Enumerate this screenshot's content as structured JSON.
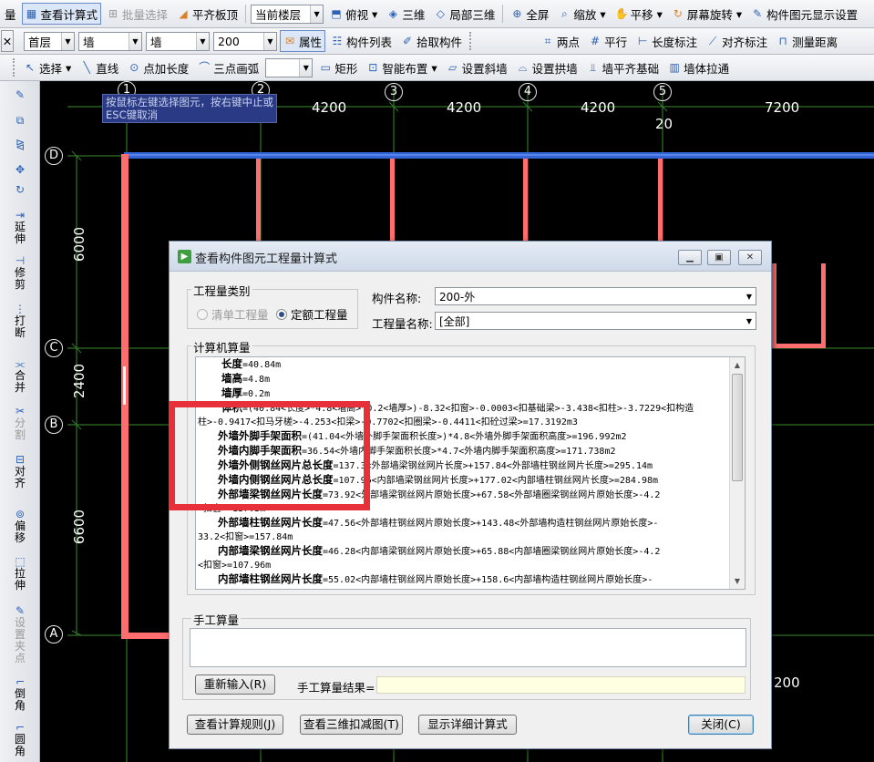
{
  "toolbar1": {
    "cut_label": "量",
    "view_calc": "查看计算式",
    "batch_select": "批量选择",
    "align_slab": "平齐板顶",
    "floor_combo": "当前楼层",
    "top_view": "俯视",
    "three_d": "三维",
    "local_3d": "局部三维",
    "fullscreen": "全屏",
    "zoom": "缩放",
    "pan": "平移",
    "rotate": "屏幕旋转",
    "display_settings": "构件图元显示设置"
  },
  "toolbar2": {
    "floor": "首层",
    "type1": "墙",
    "type2": "墙",
    "value": "200",
    "properties": "属性",
    "component_list": "构件列表",
    "pick": "拾取构件",
    "two_points": "两点",
    "parallel": "平行",
    "length_dim": "长度标注",
    "aligned_dim": "对齐标注",
    "measure": "测量距离"
  },
  "toolbar3": {
    "select": "选择",
    "line": "直线",
    "point_length": "点加长度",
    "arc3": "三点画弧",
    "rect": "矩形",
    "smart_layout": "智能布置",
    "slope_wall": "设置斜墙",
    "arch_wall": "设置拱墙",
    "wall_align": "墙平齐基础",
    "wall_stretch": "墙体拉通"
  },
  "left_tools": {
    "extend": "延伸",
    "trim": "修剪",
    "break": "打断",
    "merge": "合并",
    "split": "分割",
    "align": "对齐",
    "offset": "偏移",
    "stretch": "拉伸",
    "set_point": "设置夹点",
    "chamfer": "倒角",
    "fillet": "圆角"
  },
  "canvas": {
    "hint": "按鼠标左键选择图元，按右键中止或ESC键取消",
    "axis_x": [
      "1",
      "2",
      "3",
      "4",
      "5"
    ],
    "axis_y": [
      "D",
      "C",
      "B",
      "A"
    ],
    "dim_top": [
      "4200",
      "4200",
      "4200",
      "7200"
    ],
    "dim_20": "20",
    "dim_left": [
      "6000",
      "2400",
      "6600"
    ],
    "dim_bottom_right": "200"
  },
  "dialog": {
    "title": "查看构件图元工程量计算式",
    "type_group": "工程量类别",
    "radio_bill": "清单工程量",
    "radio_quota": "定额工程量",
    "comp_name_label": "构件名称:",
    "comp_name_value": "200-外",
    "qty_name_label": "工程量名称:",
    "qty_name_value": "[全部]",
    "calc_label": "计算机算量",
    "manual_label": "手工算量",
    "reinput": "重新输入(R)",
    "manual_result_label": "手工算量结果=",
    "btn_rules": "查看计算规则(J)",
    "btn_3d": "查看三维扣减图(T)",
    "btn_detail": "显示详细计算式",
    "btn_close": "关闭(C)"
  },
  "calc_lines": [
    {
      "bold": "长度",
      "rest": "=40.84m"
    },
    {
      "bold": "墙高",
      "rest": "=4.8m"
    },
    {
      "bold": "墙厚",
      "rest": "=0.2m"
    },
    {
      "bold": "体积",
      "rest": "=(40.84<长度>*4.8<墙高>*0.2<墙厚>)-8.32<扣窗>-0.0003<扣基础梁>-3.438<扣柱>-3.7229<扣构造"
    },
    {
      "bold": "",
      "rest": "柱>-0.9417<扣马牙槎>-4.253<扣梁>-0.7702<扣圈梁>-0.4411<扣砼过梁>=17.3192m3"
    },
    {
      "bold": "外墙外脚手架面积",
      "rest": "=(41.04<外墙外脚手架面积长度>)*4.8<外墙外脚手架面积高度>=196.992m2"
    },
    {
      "bold": "外墙内脚手架面积",
      "rest": "=36.54<外墙内脚手架面积长度>*4.7<外墙内脚手架面积高度>=171.738m2"
    },
    {
      "bold": "外墙外侧钢丝网片总长度",
      "rest": "=137.3<外部墙梁钢丝网片长度>+157.84<外部墙柱钢丝网片长度>=295.14m"
    },
    {
      "bold": "外墙内侧钢丝网片总长度",
      "rest": "=107.96<内部墙梁钢丝网片长度>+177.02<内部墙柱钢丝网片长度>=284.98m"
    },
    {
      "bold": "外部墙梁钢丝网片长度",
      "rest": "=73.92<外部墙梁钢丝网片原始长度>+67.58<外部墙圈梁钢丝网片原始长度>-4.2"
    },
    {
      "bold": "",
      "rest": "<扣窗>=137.3m"
    },
    {
      "bold": "外部墙柱钢丝网片长度",
      "rest": "=47.56<外部墙柱钢丝网片原始长度>+143.48<外部墙构造柱钢丝网片原始长度>-"
    },
    {
      "bold": "",
      "rest": "33.2<扣窗>=157.84m"
    },
    {
      "bold": "内部墙梁钢丝网片长度",
      "rest": "=46.28<内部墙梁钢丝网片原始长度>+65.88<内部墙圈梁钢丝网片原始长度>-4.2"
    },
    {
      "bold": "",
      "rest": "<扣窗>=107.96m"
    },
    {
      "bold": "内部墙柱钢丝网片长度",
      "rest": "=55.02<内部墙柱钢丝网片原始长度>+158.6<内部墙构造柱钢丝网片原始长度>-"
    }
  ],
  "calc_indent": [
    2,
    2,
    2,
    2,
    0,
    1,
    1,
    1,
    1,
    1,
    0,
    1,
    0,
    1,
    0,
    1
  ]
}
